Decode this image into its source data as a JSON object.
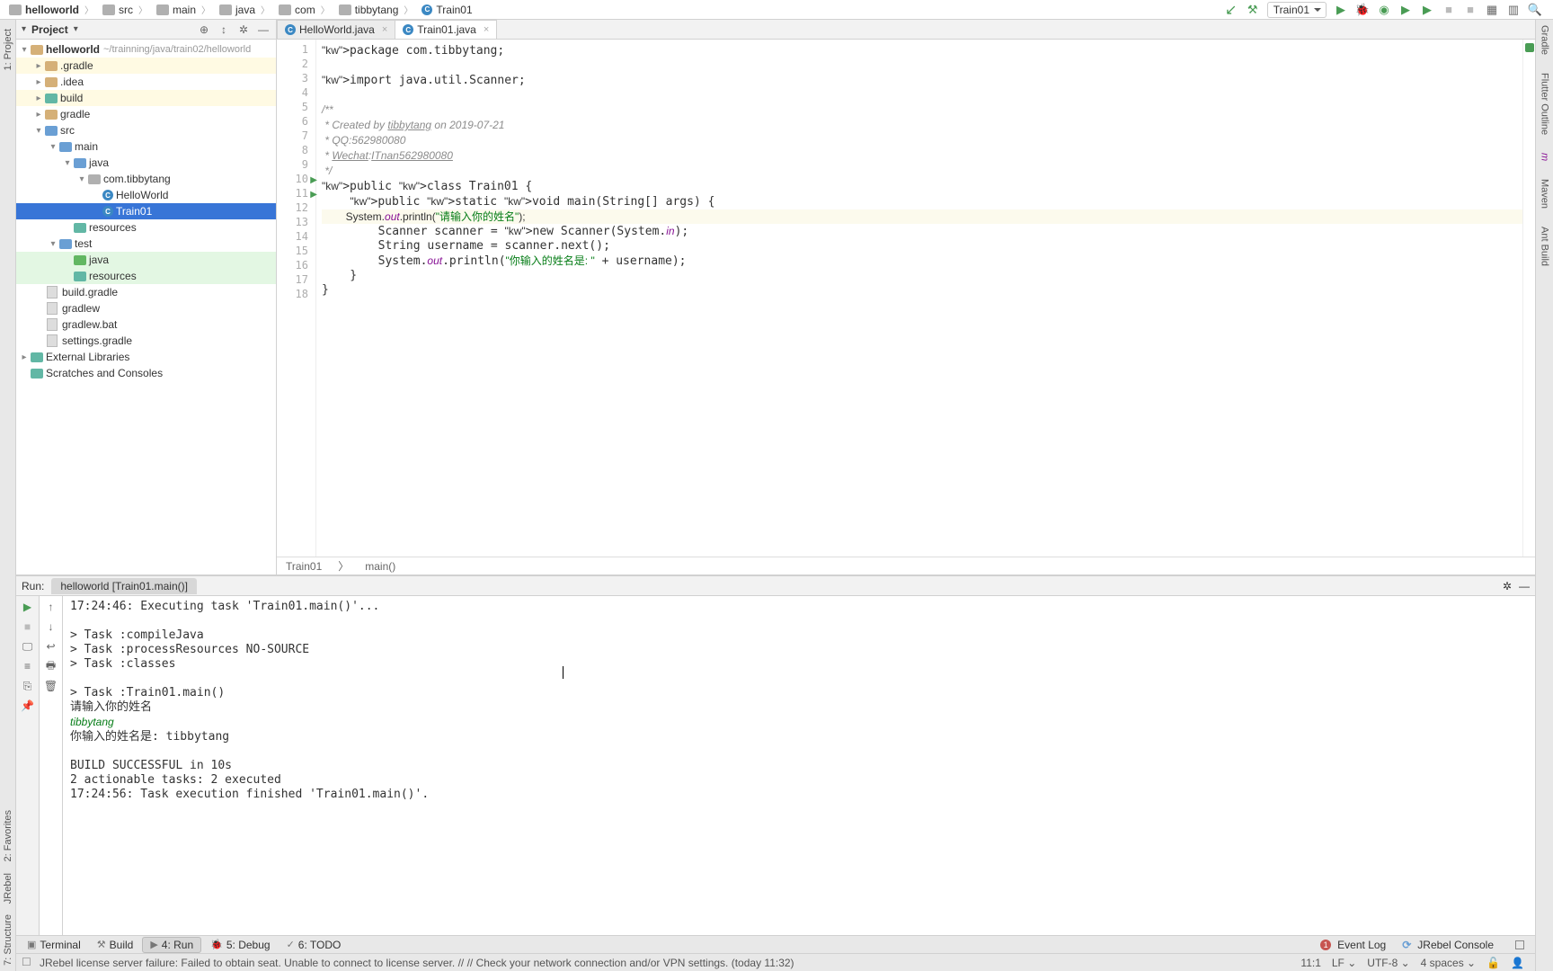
{
  "breadcrumbs": [
    "helloworld",
    "src",
    "main",
    "java",
    "com",
    "tibbytang",
    "Train01"
  ],
  "nav": {
    "run_config": "Train01"
  },
  "project": {
    "header": "Project",
    "root": {
      "name": "helloworld",
      "path": "~/trainning/java/train02/helloworld"
    },
    "nodes": [
      ".gradle",
      ".idea",
      "build",
      "gradle",
      "src",
      "main",
      "java",
      "com.tibbytang",
      "HelloWorld",
      "Train01",
      "resources",
      "test",
      "java",
      "resources",
      "build.gradle",
      "gradlew",
      "gradlew.bat",
      "settings.gradle",
      "External Libraries",
      "Scratches and Consoles"
    ]
  },
  "tabs": [
    {
      "name": "HelloWorld.java",
      "active": false
    },
    {
      "name": "Train01.java",
      "active": true
    }
  ],
  "code": {
    "lines": [
      {
        "n": 1,
        "raw": "package com.tibbytang;"
      },
      {
        "n": 2,
        "raw": ""
      },
      {
        "n": 3,
        "raw": "import java.util.Scanner;"
      },
      {
        "n": 4,
        "raw": ""
      },
      {
        "n": 5,
        "raw": "/**"
      },
      {
        "n": 6,
        "raw": " * Created by tibbytang on 2019-07-21"
      },
      {
        "n": 7,
        "raw": " * QQ:562980080"
      },
      {
        "n": 8,
        "raw": " * Wechat:ITnan562980080"
      },
      {
        "n": 9,
        "raw": " */"
      },
      {
        "n": 10,
        "raw": "public class Train01 {"
      },
      {
        "n": 11,
        "raw": "    public static void main(String[] args) {"
      },
      {
        "n": 12,
        "raw": "        System.out.println(\"请输入你的姓名\");"
      },
      {
        "n": 13,
        "raw": "        Scanner scanner = new Scanner(System.in);"
      },
      {
        "n": 14,
        "raw": "        String username = scanner.next();"
      },
      {
        "n": 15,
        "raw": "        System.out.println(\"你输入的姓名是: \" + username);"
      },
      {
        "n": 16,
        "raw": "    }"
      },
      {
        "n": 17,
        "raw": "}"
      },
      {
        "n": 18,
        "raw": ""
      }
    ]
  },
  "editor_crumbs": [
    "Train01",
    "main()"
  ],
  "run": {
    "label": "Run:",
    "tab": "helloworld [Train01.main()]",
    "output": [
      "17:24:46: Executing task 'Train01.main()'...",
      "",
      "> Task :compileJava",
      "> Task :processResources NO-SOURCE",
      "> Task :classes",
      "",
      "> Task :Train01.main()",
      "请输入你的姓名",
      {
        "user": "tibbytang"
      },
      "你输入的姓名是: tibbytang",
      "",
      "BUILD SUCCESSFUL in 10s",
      "2 actionable tasks: 2 executed",
      "17:24:56: Task execution finished 'Train01.main()'."
    ]
  },
  "bottom_tabs": [
    "Terminal",
    "Build",
    "4: Run",
    "5: Debug",
    "6: TODO"
  ],
  "bottom_right": [
    "Event Log",
    "JRebel Console"
  ],
  "status": {
    "msg": "JRebel license server failure: Failed to obtain seat. Unable to connect to license server. // // Check your network connection and/or VPN settings. (today 11:32)",
    "pos": "11:1",
    "le": "LF",
    "enc": "UTF-8",
    "indent": "4 spaces"
  },
  "right_tools": [
    "Gradle",
    "Flutter Outline",
    "Maven",
    "Ant Build"
  ],
  "left_tools": [
    "1: Project",
    "2: Favorites",
    "JRebel",
    "7: Structure"
  ]
}
